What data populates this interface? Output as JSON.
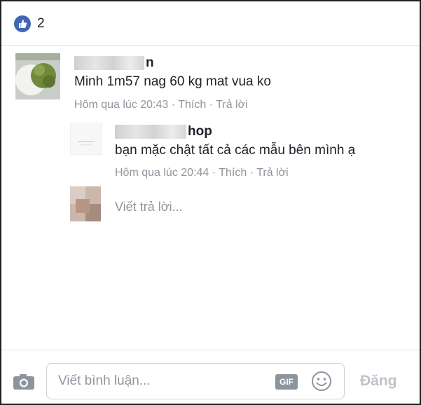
{
  "reactions": {
    "icon": "like-thumb-icon",
    "count": "2",
    "color": "#4267b2"
  },
  "comment": {
    "author_suffix": "n",
    "text": "Minh 1m57 nag 60 kg mat vua ko",
    "time": "Hôm qua lúc 20:43",
    "like_label": "Thích",
    "reply_label": "Trả lời",
    "separator": "·"
  },
  "reply": {
    "author_suffix": "hop",
    "text": "bạn mặc chật tất cả các mẫu bên mình ạ",
    "time": "Hôm qua lúc 20:44",
    "like_label": "Thích",
    "reply_label": "Trả lời",
    "separator": "·"
  },
  "reply_box": {
    "placeholder": "Viết trả lời..."
  },
  "composer": {
    "placeholder": "Viết bình luận...",
    "gif_label": "GIF",
    "post_label": "Đăng",
    "camera_icon": "camera-icon",
    "emoji_icon": "smiley-icon"
  }
}
